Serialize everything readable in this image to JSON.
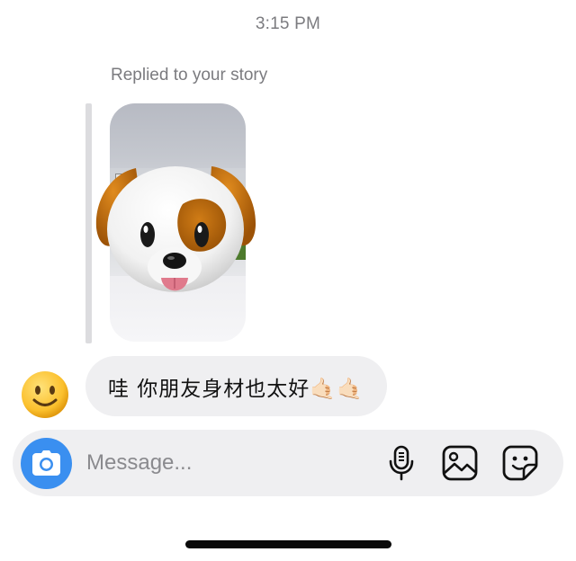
{
  "timestamp": "3:15 PM",
  "reply": {
    "label": "Replied to your story",
    "sticker_icon": "dog-face-memoji"
  },
  "message": {
    "text": "哇 你朋友身材也太好🤙🏻🤙🏻",
    "avatar_icon": "smiling-face-emoji"
  },
  "composer": {
    "placeholder": "Message...",
    "value": "",
    "camera_icon": "camera-icon",
    "mic_icon": "microphone-icon",
    "gallery_icon": "image-icon",
    "sticker_icon": "sticker-icon",
    "accent_color": "#3a8ff0"
  }
}
